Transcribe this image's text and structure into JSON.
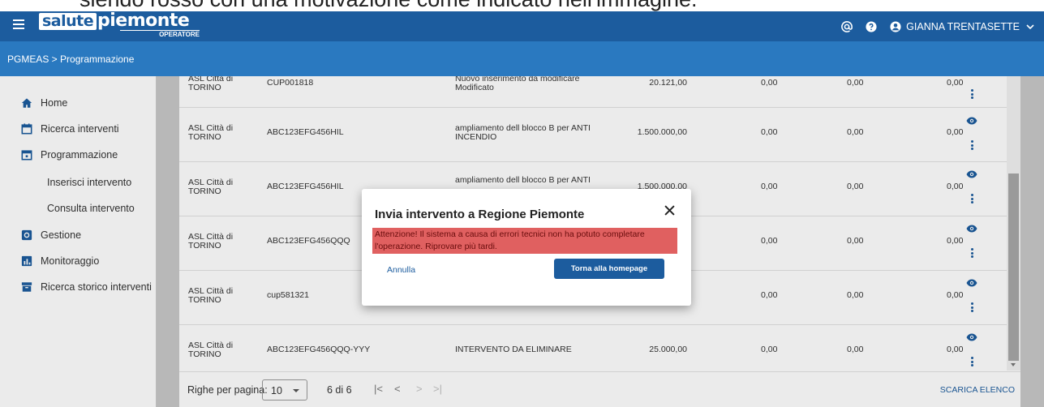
{
  "caption": "siendo rosso con una motivazione come indicato nell'immagine.",
  "header": {
    "brand_box": "salute",
    "brand_name": "piemonte",
    "brand_sub": "OPERATORE",
    "user_name": "GIANNA TRENTASETTE",
    "icons": [
      "at-icon",
      "help-icon",
      "user-icon",
      "chevron-down-icon"
    ],
    "color": "#1c5c9e"
  },
  "breadcrumb": "PGMEAS > Programmazione",
  "sidebar": {
    "items": [
      {
        "label": "Home",
        "icon": "home-icon"
      },
      {
        "label": "Ricerca interventi",
        "icon": "calendar-icon"
      },
      {
        "label": "Programmazione",
        "icon": "calendar-icon"
      },
      {
        "label": "Inserisci intervento",
        "icon": ""
      },
      {
        "label": "Consulta intervento",
        "icon": ""
      },
      {
        "label": "Gestione",
        "icon": "settings-icon"
      },
      {
        "label": "Monitoraggio",
        "icon": "chart-icon"
      },
      {
        "label": "Ricerca storico interventi",
        "icon": "archive-icon"
      }
    ]
  },
  "table": {
    "rows": [
      {
        "asl": "ASL Città di TORINO",
        "cup": "CUP001818",
        "desc": "Nuovo inserimento da modificare Modificato",
        "importo": "20.121,00",
        "v1": "0,00",
        "v2": "0,00",
        "v3": "0,00"
      },
      {
        "asl": "ASL Città di TORINO",
        "cup": "ABC123EFG456HIL",
        "desc": "ampliamento dell blocco B per ANTI INCENDIO",
        "importo": "1.500.000,00",
        "v1": "0,00",
        "v2": "0,00",
        "v3": "0,00"
      },
      {
        "asl": "ASL Città di TORINO",
        "cup": "ABC123EFG456HIL",
        "desc": "ampliamento dell blocco B per ANTI",
        "importo": "1.500.000,00",
        "v1": "0,00",
        "v2": "0,00",
        "v3": "0,00"
      },
      {
        "asl": "ASL Città di TORINO",
        "cup": "ABC123EFG456QQQ",
        "desc": "",
        "importo": "",
        "v1": "0,00",
        "v2": "0,00",
        "v3": "0,00"
      },
      {
        "asl": "ASL Città di TORINO",
        "cup": "cup581321",
        "desc": "",
        "importo": "",
        "v1": "0,00",
        "v2": "0,00",
        "v3": "0,00"
      },
      {
        "asl": "ASL Città di TORINO",
        "cup": "ABC123EFG456QQQ-YYY",
        "desc": "INTERVENTO DA ELIMINARE",
        "importo": "25.000,00",
        "v1": "0,00",
        "v2": "0,00",
        "v3": "0,00"
      }
    ]
  },
  "footer": {
    "rows_per_page_label": "Righe per pagina:",
    "rows_per_page_value": "10",
    "page_info": "6 di 6",
    "first": "|<",
    "prev": "<",
    "next": ">",
    "last": ">|",
    "download": "SCARICA ELENCO"
  },
  "modal": {
    "title": "Invia intervento a Regione Piemonte",
    "alert_line1": "Attenzione! Il sistema a causa di errori tecnici non ha potuto completare",
    "alert_line2": "l'operazione. Riprovare più tardi.",
    "cancel_label": "Annulla",
    "primary_label": "Torna alla homepage",
    "alert_color": "#e06060"
  }
}
